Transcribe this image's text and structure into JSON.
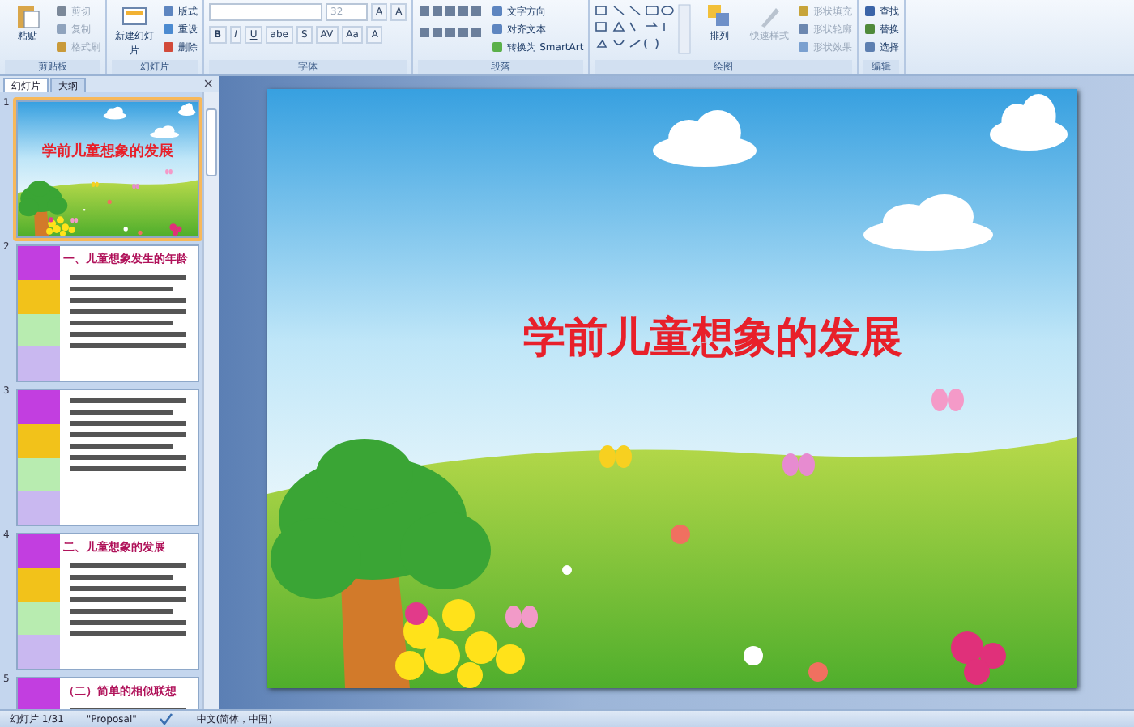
{
  "ribbon": {
    "groups": [
      {
        "label": "剪贴板",
        "items": [
          {
            "kind": "large",
            "label": "粘贴",
            "disabled": false
          },
          {
            "kind": "small",
            "label": "剪切",
            "disabled": true
          },
          {
            "kind": "small",
            "label": "复制",
            "disabled": true
          },
          {
            "kind": "small",
            "label": "格式刷",
            "disabled": true
          }
        ]
      },
      {
        "label": "幻灯片",
        "items": [
          {
            "kind": "large",
            "label": "新建幻灯片",
            "disabled": false
          },
          {
            "kind": "small",
            "label": "版式",
            "disabled": false
          },
          {
            "kind": "small",
            "label": "重设",
            "disabled": false
          },
          {
            "kind": "small",
            "label": "删除",
            "disabled": false
          }
        ]
      },
      {
        "label": "字体",
        "items": [
          {
            "kind": "font",
            "size": "32",
            "row1": [
              "A",
              "A"
            ],
            "row2": [
              "B",
              "I",
              "U",
              "abe",
              "S",
              "AV",
              "Aa",
              "A"
            ]
          }
        ]
      },
      {
        "label": "段落",
        "items": [
          {
            "kind": "para"
          },
          {
            "kind": "small",
            "label": "文字方向",
            "disabled": false
          },
          {
            "kind": "small",
            "label": "对齐文本",
            "disabled": false
          },
          {
            "kind": "small",
            "label": "转换为 SmartArt",
            "disabled": false
          }
        ]
      },
      {
        "label": "绘图",
        "items": [
          {
            "kind": "shapes"
          },
          {
            "kind": "large",
            "label": "排列",
            "disabled": false
          },
          {
            "kind": "large",
            "label": "快速样式",
            "disabled": true
          },
          {
            "kind": "small",
            "label": "形状填充",
            "disabled": true
          },
          {
            "kind": "small",
            "label": "形状轮廓",
            "disabled": true
          },
          {
            "kind": "small",
            "label": "形状效果",
            "disabled": true
          }
        ]
      },
      {
        "label": "编辑",
        "items": [
          {
            "kind": "small",
            "label": "查找",
            "disabled": false
          },
          {
            "kind": "small",
            "label": "替换",
            "disabled": false
          },
          {
            "kind": "small",
            "label": "选择",
            "disabled": false
          }
        ]
      }
    ]
  },
  "panel": {
    "tabs": [
      {
        "label": "幻灯片",
        "selected": true
      },
      {
        "label": "大纲",
        "selected": false
      }
    ],
    "close": "×",
    "slides": [
      {
        "number": "1",
        "selected": true,
        "kind": "cover",
        "title": "学前儿童想象的发展"
      },
      {
        "number": "2",
        "selected": false,
        "kind": "content",
        "heading": "一、儿童想象发生的年龄"
      },
      {
        "number": "3",
        "selected": false,
        "kind": "content"
      },
      {
        "number": "4",
        "selected": false,
        "kind": "content",
        "heading": "二、儿童想象的发展"
      },
      {
        "number": "5",
        "selected": false,
        "kind": "content",
        "heading": "（二）简单的相似联想"
      }
    ]
  },
  "slide": {
    "title": "学前儿童想象的发展"
  },
  "status_bar": {
    "slide": "幻灯片 1/31",
    "theme": "\"Proposal\"",
    "language": "中文(简体，中国)"
  }
}
